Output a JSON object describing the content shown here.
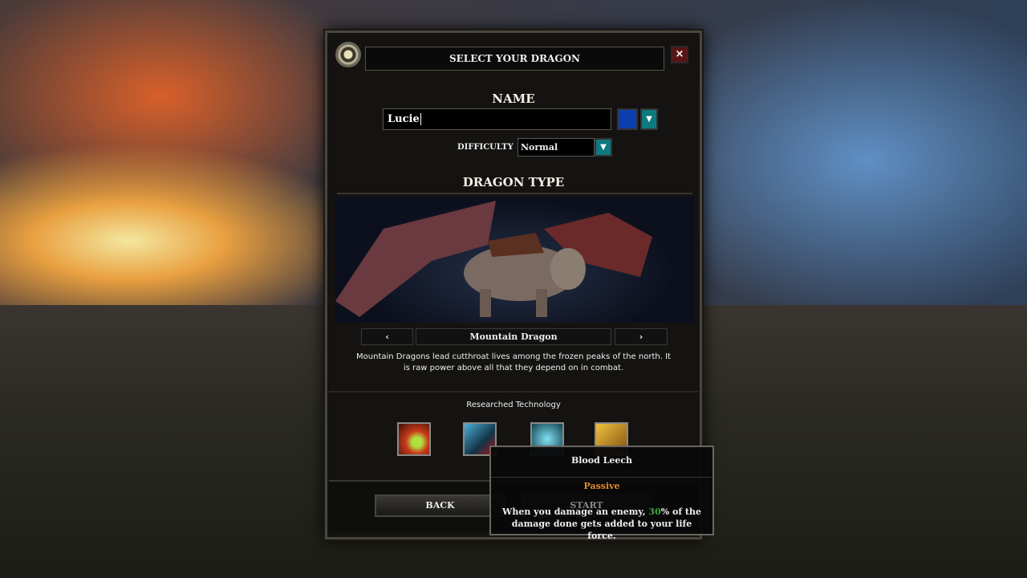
{
  "dialog": {
    "title": "SELECT YOUR DRAGON",
    "close_label": "×"
  },
  "name": {
    "heading": "NAME",
    "value": "Lucie",
    "color": "#0b3fb0"
  },
  "difficulty": {
    "label": "DIFFICULTY",
    "value": "Normal"
  },
  "dragon_type": {
    "heading": "DRAGON TYPE",
    "selected": "Mountain Dragon",
    "prev_label": "‹",
    "next_label": "›",
    "description": "Mountain Dragons lead cutthroat lives among the frozen peaks of the north. It is raw power above all that they depend on in combat."
  },
  "technology": {
    "heading": "Researched Technology",
    "items": [
      {
        "icon": "fire-breath-icon"
      },
      {
        "icon": "blood-leech-icon"
      },
      {
        "icon": "frost-icon"
      },
      {
        "icon": "golden-claw-icon"
      }
    ]
  },
  "buttons": {
    "back": "BACK",
    "start": "START"
  },
  "tooltip": {
    "title": "Blood Leech",
    "type": "Passive",
    "text_before": "When you damage an enemy, ",
    "highlight": "30",
    "text_after": "% of the damage done gets added to your life force.",
    "type_color": "#e08a2a",
    "highlight_color": "#3aaa3a"
  }
}
